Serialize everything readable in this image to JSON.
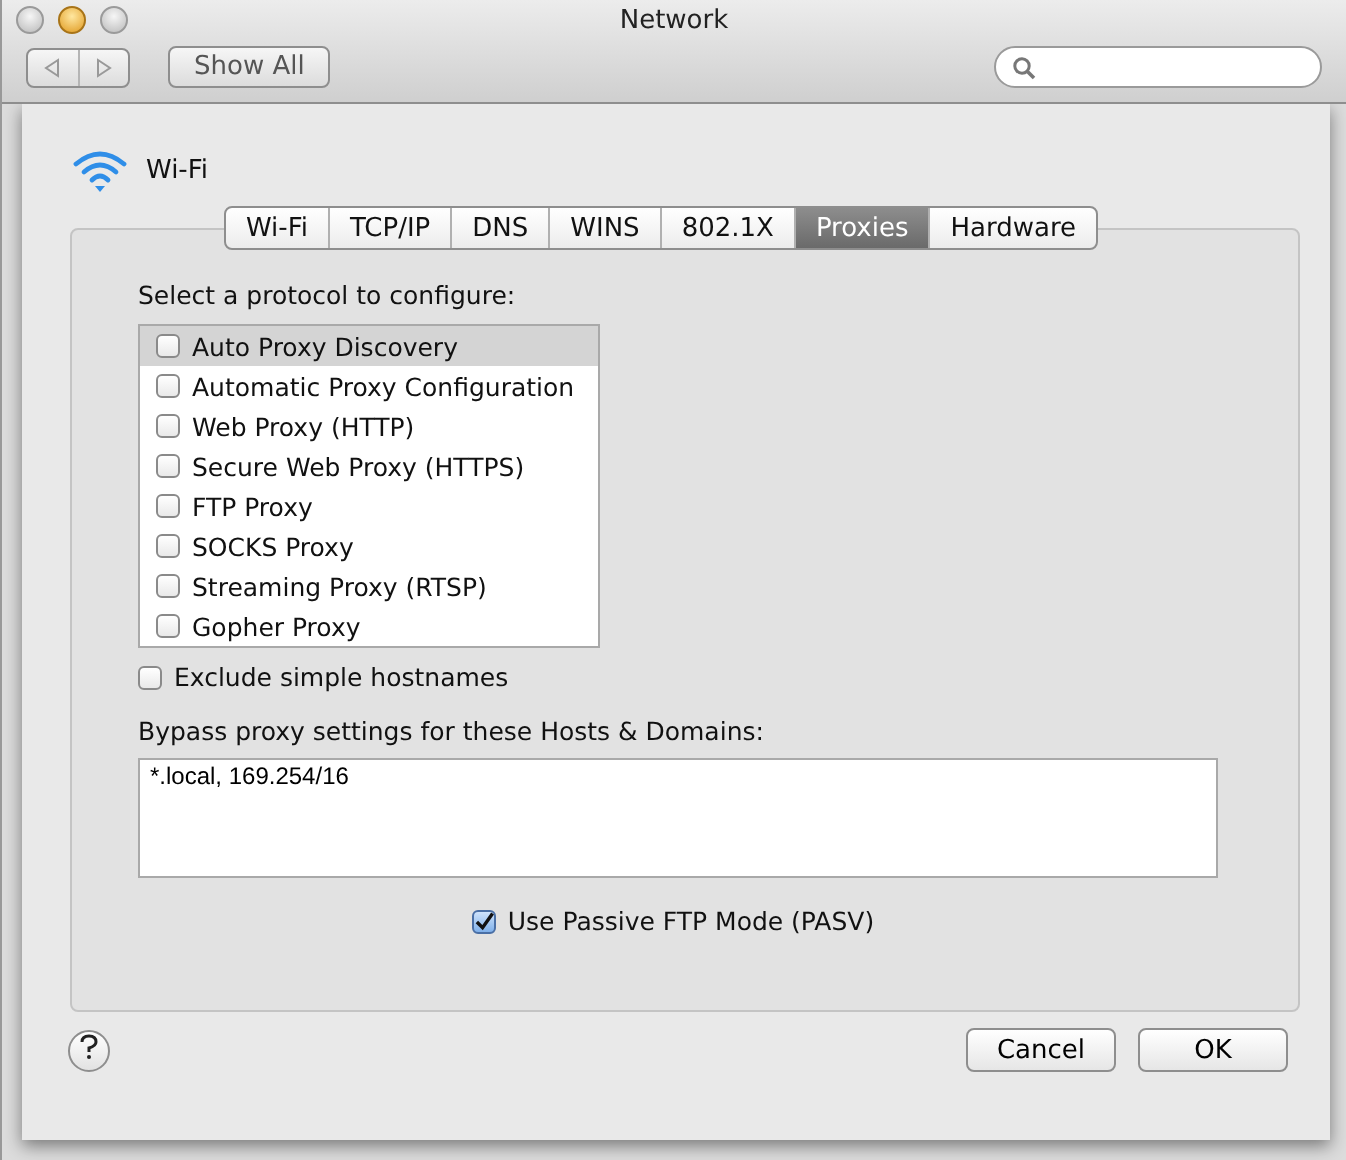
{
  "window": {
    "title": "Network"
  },
  "toolbar": {
    "show_all": "Show All"
  },
  "service": {
    "name": "Wi-Fi"
  },
  "tabs": [
    {
      "label": "Wi-Fi",
      "selected": false
    },
    {
      "label": "TCP/IP",
      "selected": false
    },
    {
      "label": "DNS",
      "selected": false
    },
    {
      "label": "WINS",
      "selected": false
    },
    {
      "label": "802.1X",
      "selected": false
    },
    {
      "label": "Proxies",
      "selected": true
    },
    {
      "label": "Hardware",
      "selected": false
    }
  ],
  "protocol_label": "Select a protocol to configure:",
  "protocols": [
    {
      "label": "Auto Proxy Discovery",
      "checked": false,
      "selected": true
    },
    {
      "label": "Automatic Proxy Configuration",
      "checked": false,
      "selected": false
    },
    {
      "label": "Web Proxy (HTTP)",
      "checked": false,
      "selected": false
    },
    {
      "label": "Secure Web Proxy (HTTPS)",
      "checked": false,
      "selected": false
    },
    {
      "label": "FTP Proxy",
      "checked": false,
      "selected": false
    },
    {
      "label": "SOCKS Proxy",
      "checked": false,
      "selected": false
    },
    {
      "label": "Streaming Proxy (RTSP)",
      "checked": false,
      "selected": false
    },
    {
      "label": "Gopher Proxy",
      "checked": false,
      "selected": false
    }
  ],
  "exclude_simple": {
    "label": "Exclude simple hostnames",
    "checked": false
  },
  "bypass": {
    "label": "Bypass proxy settings for these Hosts & Domains:",
    "value": "*.local, 169.254/16"
  },
  "passive_ftp": {
    "label": "Use Passive FTP Mode (PASV)",
    "checked": true
  },
  "buttons": [
    {
      "label": "Cancel",
      "kind": "normal"
    },
    {
      "label": "OK",
      "kind": "normal"
    }
  ]
}
